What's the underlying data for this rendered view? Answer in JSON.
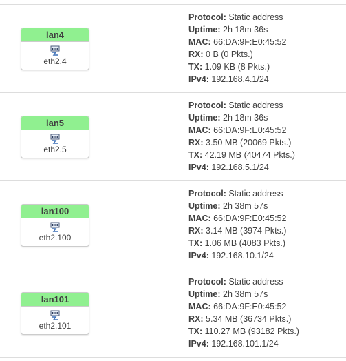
{
  "labels": {
    "protocol": "Protocol:",
    "uptime": "Uptime:",
    "mac": "MAC:",
    "rx": "RX:",
    "tx": "TX:",
    "ipv4": "IPv4:"
  },
  "colors": {
    "header_bg": "#90f090",
    "border": "#cccccc",
    "divider": "#dddddd"
  },
  "icons": {
    "port": "ethernet-port-icon"
  },
  "interfaces": [
    {
      "name": "lan4",
      "device": "eth2.4",
      "protocol": "Static address",
      "uptime": "2h 18m 36s",
      "mac": "66:DA:9F:E0:45:52",
      "rx": "0 B (0 Pkts.)",
      "tx": "1.09 KB (8 Pkts.)",
      "ipv4": "192.168.4.1/24"
    },
    {
      "name": "lan5",
      "device": "eth2.5",
      "protocol": "Static address",
      "uptime": "2h 18m 36s",
      "mac": "66:DA:9F:E0:45:52",
      "rx": "3.50 MB (20069 Pkts.)",
      "tx": "42.19 MB (40474 Pkts.)",
      "ipv4": "192.168.5.1/24"
    },
    {
      "name": "lan100",
      "device": "eth2.100",
      "protocol": "Static address",
      "uptime": "2h 38m 57s",
      "mac": "66:DA:9F:E0:45:52",
      "rx": "3.14 MB (3974 Pkts.)",
      "tx": "1.06 MB (4083 Pkts.)",
      "ipv4": "192.168.10.1/24"
    },
    {
      "name": "lan101",
      "device": "eth2.101",
      "protocol": "Static address",
      "uptime": "2h 38m 57s",
      "mac": "66:DA:9F:E0:45:52",
      "rx": "5.34 MB (36734 Pkts.)",
      "tx": "110.27 MB (93182 Pkts.)",
      "ipv4": "192.168.101.1/24"
    }
  ]
}
